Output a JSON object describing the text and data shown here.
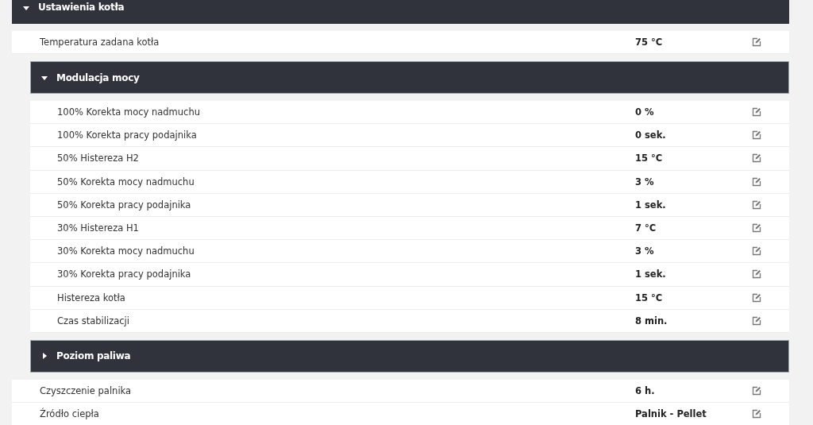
{
  "section": {
    "title": "Ustawienia kotła",
    "expanded": true,
    "items": [
      {
        "kind": "row",
        "label": "Temperatura zadana kotła",
        "value": "75 °C"
      },
      {
        "kind": "group",
        "title": "Modulacja mocy",
        "expanded": true,
        "children": [
          {
            "kind": "row",
            "label": "100% Korekta mocy nadmuchu",
            "value": "0 %"
          },
          {
            "kind": "row",
            "label": "100% Korekta pracy podajnika",
            "value": "0 sek."
          },
          {
            "kind": "row",
            "label": "50% Histereza H2",
            "value": "15 °C"
          },
          {
            "kind": "row",
            "label": "50% Korekta mocy nadmuchu",
            "value": "3 %"
          },
          {
            "kind": "row",
            "label": "50% Korekta pracy podajnika",
            "value": "1 sek."
          },
          {
            "kind": "row",
            "label": "30% Histereza H1",
            "value": "7 °C"
          },
          {
            "kind": "row",
            "label": "30% Korekta mocy nadmuchu",
            "value": "3 %"
          },
          {
            "kind": "row",
            "label": "30% Korekta pracy podajnika",
            "value": "1 sek."
          },
          {
            "kind": "row",
            "label": "Histereza kotła",
            "value": "15 °C"
          },
          {
            "kind": "row",
            "label": "Czas stabilizacji",
            "value": "8 min."
          }
        ]
      },
      {
        "kind": "group",
        "title": "Poziom paliwa",
        "expanded": false
      },
      {
        "kind": "row",
        "label": "Czyszczenie palnika",
        "value": "6 h."
      },
      {
        "kind": "row",
        "label": "Źródło ciepła",
        "value": "Palnik - Pellet"
      }
    ]
  }
}
